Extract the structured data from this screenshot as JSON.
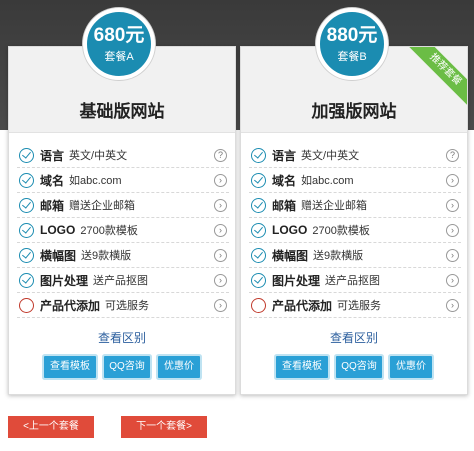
{
  "packages": [
    {
      "price": "680元",
      "package_name": "套餐A",
      "title": "基础版网站",
      "features": [
        {
          "label": "语言",
          "value": "英文/中英文",
          "info": "?"
        },
        {
          "label": "域名",
          "value": "如abc.com",
          "info": "›"
        },
        {
          "label": "邮箱",
          "value": "赠送企业邮箱",
          "info": "›"
        },
        {
          "label": "LOGO",
          "value": "2700款模板",
          "info": "›"
        },
        {
          "label": "横幅图",
          "value": "送9款横版",
          "info": "›"
        },
        {
          "label": "图片处理",
          "value": "送产品抠图",
          "info": "›"
        },
        {
          "label": "产品代添加",
          "value": "可选服务",
          "info": "›"
        }
      ],
      "compare_link": "查看区别",
      "buttons": [
        "查看模板",
        "QQ咨询",
        "优惠价"
      ]
    },
    {
      "price": "880元",
      "package_name": "套餐B",
      "title": "加强版网站",
      "ribbon": "推荐套餐",
      "features": [
        {
          "label": "语言",
          "value": "英文/中英文",
          "info": "?"
        },
        {
          "label": "域名",
          "value": "如abc.com",
          "info": "›"
        },
        {
          "label": "邮箱",
          "value": "赠送企业邮箱",
          "info": "›"
        },
        {
          "label": "LOGO",
          "value": "2700款模板",
          "info": "›"
        },
        {
          "label": "横幅图",
          "value": "送9款横版",
          "info": "›"
        },
        {
          "label": "图片处理",
          "value": "送产品抠图",
          "info": "›"
        },
        {
          "label": "产品代添加",
          "value": "可选服务",
          "info": "›"
        }
      ],
      "compare_link": "查看区别",
      "buttons": [
        "查看模板",
        "QQ咨询",
        "优惠价"
      ]
    }
  ],
  "nav": {
    "prev_label": "<上一个套餐",
    "next_label": "下一个套餐>"
  },
  "colors": {
    "accent": "#1b8cb1",
    "button": "#2aa0d6",
    "nav_button": "#e04b3a",
    "ribbon": "#6bbd45",
    "link": "#2c5f9e"
  }
}
